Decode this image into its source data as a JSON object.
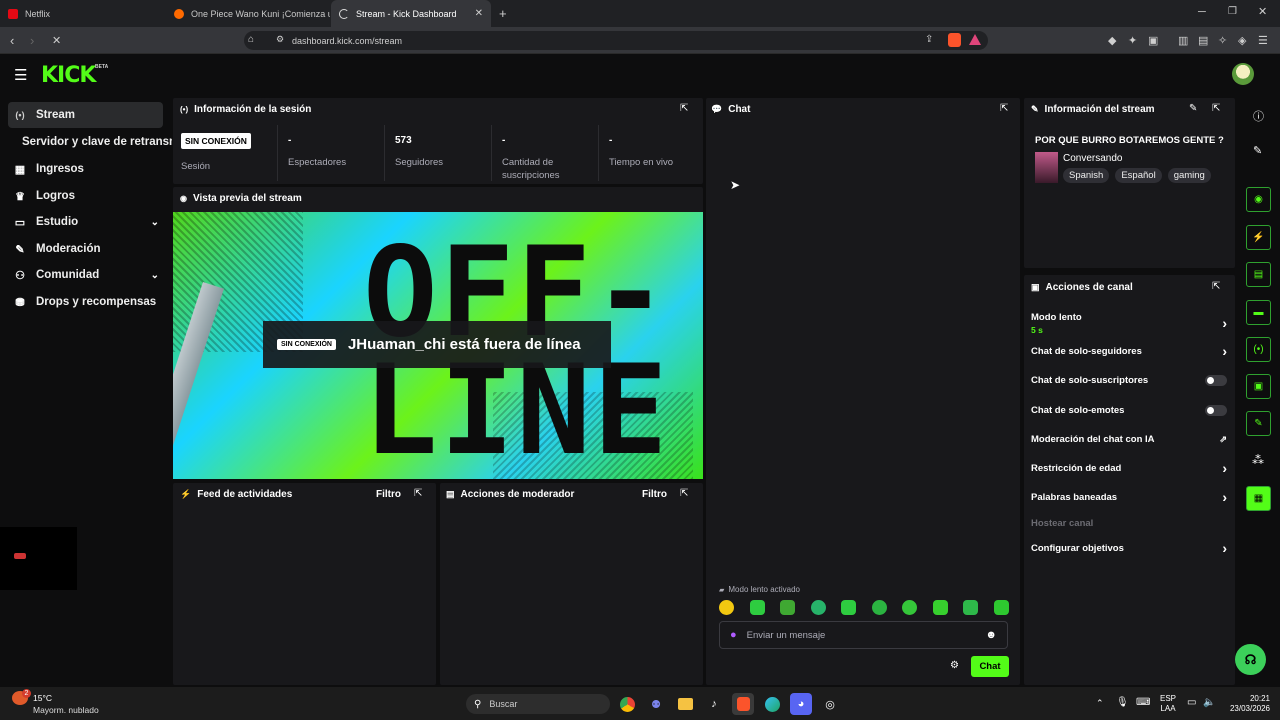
{
  "browser": {
    "tabs": [
      {
        "label": "Netflix",
        "color": "#e50914"
      },
      {
        "label": "One Piece Wano Kuni ¡Comienza un",
        "color": "#ff6a00"
      },
      {
        "label": "Stream - Kick Dashboard",
        "color": "#bbbbbb"
      }
    ],
    "url": "dashboard.kick.com/stream"
  },
  "app": {
    "logo": "KICK",
    "logo_badge": "BETA",
    "accent": "#53fc18"
  },
  "sidebar": {
    "items": [
      {
        "label": "Stream",
        "icon": "stream-icon"
      },
      {
        "label": "Servidor y clave de retransm",
        "icon": ""
      },
      {
        "label": "Ingresos",
        "icon": "chart-icon"
      },
      {
        "label": "Logros",
        "icon": "trophy-icon"
      },
      {
        "label": "Estudio",
        "icon": "studio-icon"
      },
      {
        "label": "Moderación",
        "icon": "wrench-icon"
      },
      {
        "label": "Comunidad",
        "icon": "community-icon"
      },
      {
        "label": "Drops y recompensas",
        "icon": "drops-icon"
      }
    ]
  },
  "session": {
    "title": "Información de la sesión",
    "status_badge": "SIN CONEXIÓN",
    "status_label": "Sesión",
    "stats": [
      {
        "value": "-",
        "label": "Espectadores"
      },
      {
        "value": "573",
        "label": "Seguidores"
      },
      {
        "value": "-",
        "label": "Cantidad de suscripciones"
      },
      {
        "value": "-",
        "label": "Tiempo en vivo"
      }
    ]
  },
  "preview": {
    "title": "Vista previa del stream",
    "badge": "SIN CONEXIÓN",
    "message": "JHuaman_chi está fuera de línea",
    "offline_art": "OFF-LINE"
  },
  "activity": {
    "title": "Feed de actividades",
    "filter": "Filtro"
  },
  "modactions": {
    "title": "Acciones de moderador",
    "filter": "Filtro"
  },
  "chat": {
    "title": "Chat",
    "slow_mode": "Modo lento activado",
    "placeholder": "Enviar un mensaje",
    "send_label": "Chat"
  },
  "streaminfo": {
    "title": "Información del stream",
    "stream_title": "POR QUE BURRO BOTAREMOS GENTE ?",
    "category": "Conversando",
    "tags": [
      "Spanish",
      "Español",
      "gaming"
    ]
  },
  "channel_actions": {
    "title": "Acciones de canal",
    "items": [
      {
        "label": "Modo lento",
        "sub": "5 s",
        "control": "chevron"
      },
      {
        "label": "Chat de solo-seguidores",
        "control": "chevron"
      },
      {
        "label": "Chat de solo-suscriptores",
        "control": "toggle"
      },
      {
        "label": "Chat de solo-emotes",
        "control": "toggle"
      },
      {
        "label": "Moderación del chat con IA",
        "control": "external"
      },
      {
        "label": "Restricción de edad",
        "control": "chevron"
      },
      {
        "label": "Palabras baneadas",
        "control": "chevron"
      },
      {
        "label": "Hostear canal",
        "control": "none"
      },
      {
        "label": "Configurar objetivos",
        "control": "chevron"
      }
    ]
  },
  "taskbar": {
    "weather_temp": "15°C",
    "weather_desc": "Mayorm. nublado",
    "weather_badge": "2",
    "search": "Buscar",
    "lang1": "ESP",
    "lang2": "LAA",
    "time": "20:21",
    "date": "23/03/2026"
  }
}
